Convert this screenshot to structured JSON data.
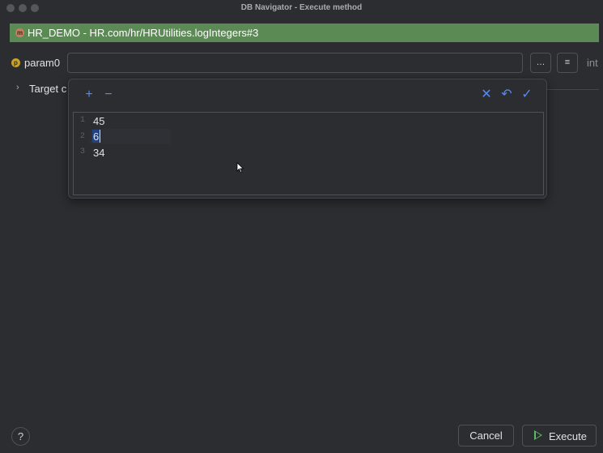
{
  "window": {
    "title": "DB Navigator - Execute method"
  },
  "banner": {
    "badge": "m",
    "text": "HR_DEMO - HR.com/hr/HRUtilities.logIntegers#3",
    "color": "#5b8a54"
  },
  "parameter": {
    "badge": "p",
    "name": "param0",
    "value": "",
    "type": "int",
    "more_button": "…",
    "list_button": "≡"
  },
  "target": {
    "label": "Target c"
  },
  "popup": {
    "toolbar": {
      "add_icon": "+",
      "remove_icon": "−",
      "clear_icon": "✕",
      "revert_icon": "↶",
      "accept_icon": "✓"
    },
    "lines": [
      {
        "number": "1",
        "text": "45"
      },
      {
        "number": "2",
        "text": "6"
      },
      {
        "number": "3",
        "text": "34"
      }
    ]
  },
  "footer": {
    "help": "?",
    "cancel": "Cancel",
    "execute": "Execute"
  },
  "colors": {
    "accent": "#548af7",
    "run": "#5fb865",
    "selection": "#214283"
  }
}
